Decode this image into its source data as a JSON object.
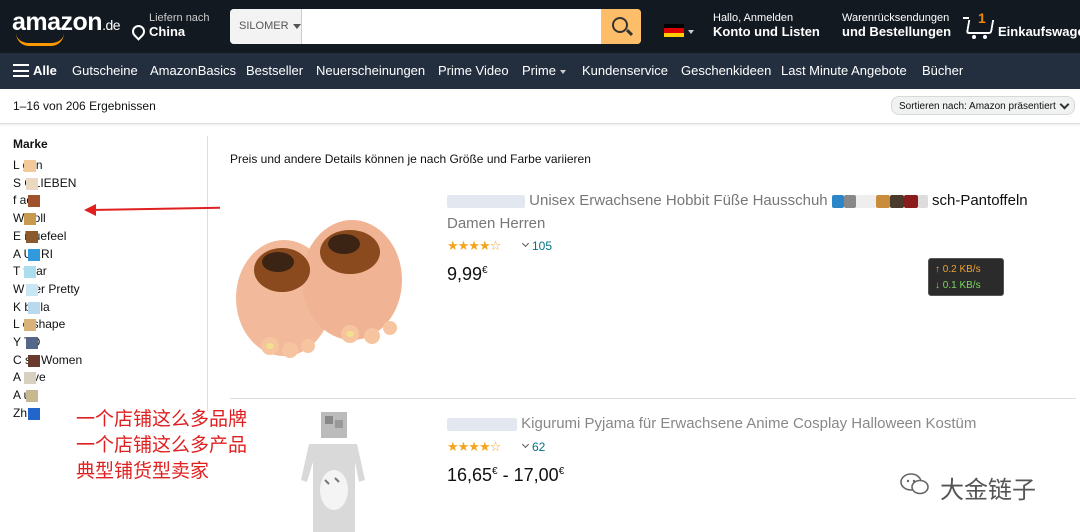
{
  "header": {
    "logo": "amazon",
    "logo_tld": ".de",
    "deliver_line1": "Liefern nach",
    "deliver_line2": "China",
    "search_category": "SILOMER",
    "search_value": "",
    "flag_colors": [
      "#000000",
      "#dd0000",
      "#ffce00"
    ],
    "account_line1": "Hallo, Anmelden",
    "account_line2": "Konto und Listen",
    "orders_line1": "Warenrücksendungen",
    "orders_line2": "und Bestellungen",
    "cart_count": "1",
    "cart_label": "Einkaufswage"
  },
  "nav": {
    "all": "Alle",
    "items": [
      "Gutscheine",
      "AmazonBasics",
      "Bestseller",
      "Neuerscheinungen",
      "Prime Video",
      "Prime",
      "Kundenservice",
      "Geschenkideen",
      "Last Minute Angebote",
      "Bücher"
    ]
  },
  "results": {
    "count": "1–16 von 206 Ergebnissen",
    "sort": "Sortieren nach: Amazon präsentiert"
  },
  "sidebar": {
    "heading": "Marke",
    "brands": [
      "L    gen",
      "S   OLIEBEN",
      "f    aoo",
      "W    zoll",
      "E    iquefeel",
      "A     URRI",
      "T    vhar",
      "W    der Pretty",
      "K    bella",
      "L    e shape",
      "Y     TO",
      "C    se Women",
      "A    love",
      "A    uz",
      "Zh     h"
    ],
    "blob_colors": [
      "#f3c99a",
      "#e8d9c0",
      "#a0522d",
      "#c89a50",
      "#8b5a2b",
      "#3399dd",
      "#aaddee",
      "#c9e6f5",
      "#b9d9ef",
      "#d9b27a",
      "#556688",
      "#6b3a2e",
      "#d8d0c0",
      "#c8b890",
      "#2266cc"
    ]
  },
  "annotation": {
    "lines": [
      "一个店铺这么多品牌",
      "一个店铺这么多产品",
      "典型铺货型卖家"
    ],
    "color": "#e02020"
  },
  "main": {
    "hint": "Preis und andere Details können je nach Größe und Farbe variieren",
    "products": [
      {
        "title_visible_1": "Unisex Erwachsene Hobbit Füße Hausschuh",
        "title_visible_2": "sch-Pantoffeln",
        "title_line2": "Damen Herren",
        "stars": "★★★★☆",
        "rating": 4.0,
        "reviews": "105",
        "price": "9,99",
        "currency": "€"
      },
      {
        "title_visible_1": "Kigurumi Pyjama für Erwachsene Anime Cosplay Halloween Kostüm",
        "stars": "★★★★☆",
        "rating": 4.5,
        "reviews": "62",
        "price": "16,65",
        "price_to": "17,00",
        "currency": "€",
        "range_sep": "-"
      }
    ]
  },
  "speed_widget": {
    "up": "↑ 0.2 KB/s",
    "down": "↓ 0.1 KB/s"
  },
  "watermark": "大金链子"
}
